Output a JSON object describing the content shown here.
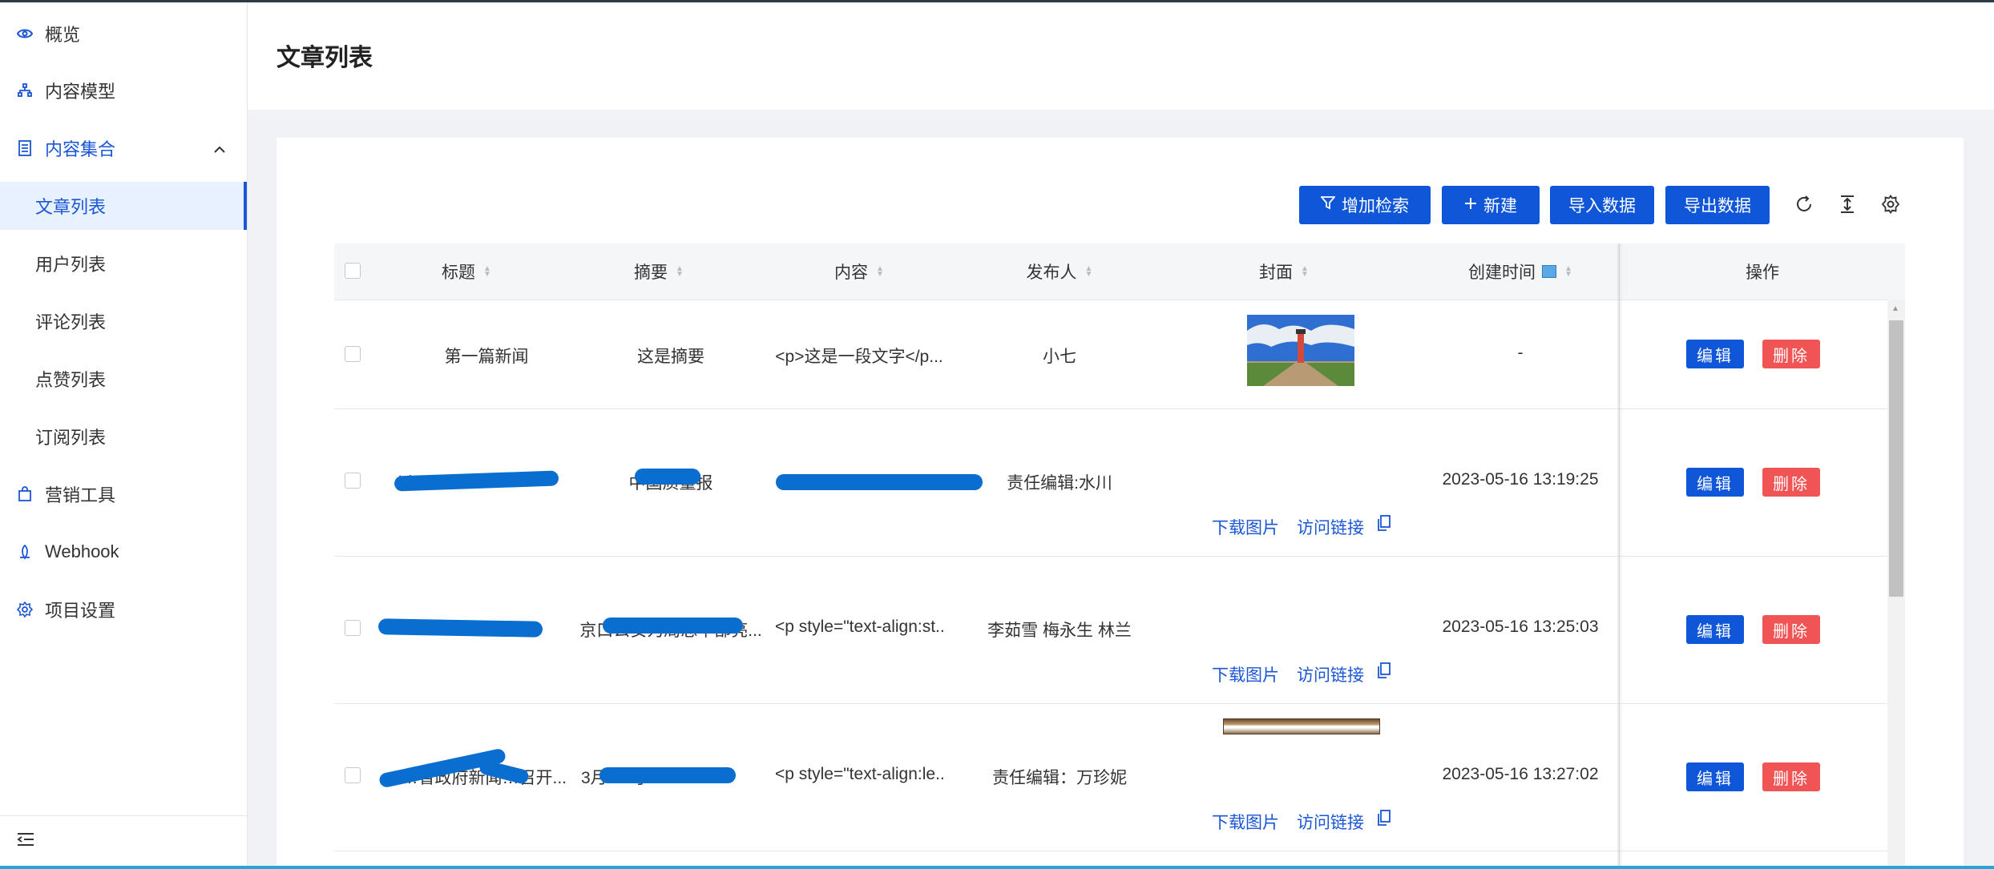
{
  "sidebar": {
    "items": [
      {
        "label": "概览"
      },
      {
        "label": "内容模型"
      },
      {
        "label": "内容集合"
      },
      {
        "label": "文章列表"
      },
      {
        "label": "用户列表"
      },
      {
        "label": "评论列表"
      },
      {
        "label": "点赞列表"
      },
      {
        "label": "订阅列表"
      },
      {
        "label": "营销工具"
      },
      {
        "label": "Webhook"
      },
      {
        "label": "项目设置"
      }
    ]
  },
  "header": {
    "title": "文章列表"
  },
  "toolbar": {
    "add_filter": "增加检索",
    "new": "新建",
    "import": "导入数据",
    "export": "导出数据"
  },
  "table": {
    "columns": [
      "标题",
      "摘要",
      "内容",
      "发布人",
      "封面",
      "创建时间",
      "操作"
    ],
    "rows": [
      {
        "title": "第一篇新闻",
        "summary": "这是摘要",
        "content": "<p>这是一段文字</p...",
        "author": "小七",
        "created": "-"
      },
      {
        "title": "以…",
        "summary": "中国质量报",
        "content": "",
        "author": "责任编辑:水川",
        "created": "2023-05-16 13:19:25"
      },
      {
        "title": "…",
        "summary": "京口公安为局总平部亮...",
        "content": "<p style=\"text-align:st...",
        "author": "李茹雪 梅永生 林兰",
        "created": "2023-05-16 13:25:03"
      },
      {
        "title": "…省政府新闻…召开...",
        "summary": "3月2…了...",
        "content": "<p style=\"text-align:le...",
        "author": "责任编辑：万珍妮",
        "created": "2023-05-16 13:27:02"
      }
    ],
    "download_label": "下载图片",
    "visit_label": "访问链接",
    "edit_label": "编辑",
    "delete_label": "删除"
  }
}
